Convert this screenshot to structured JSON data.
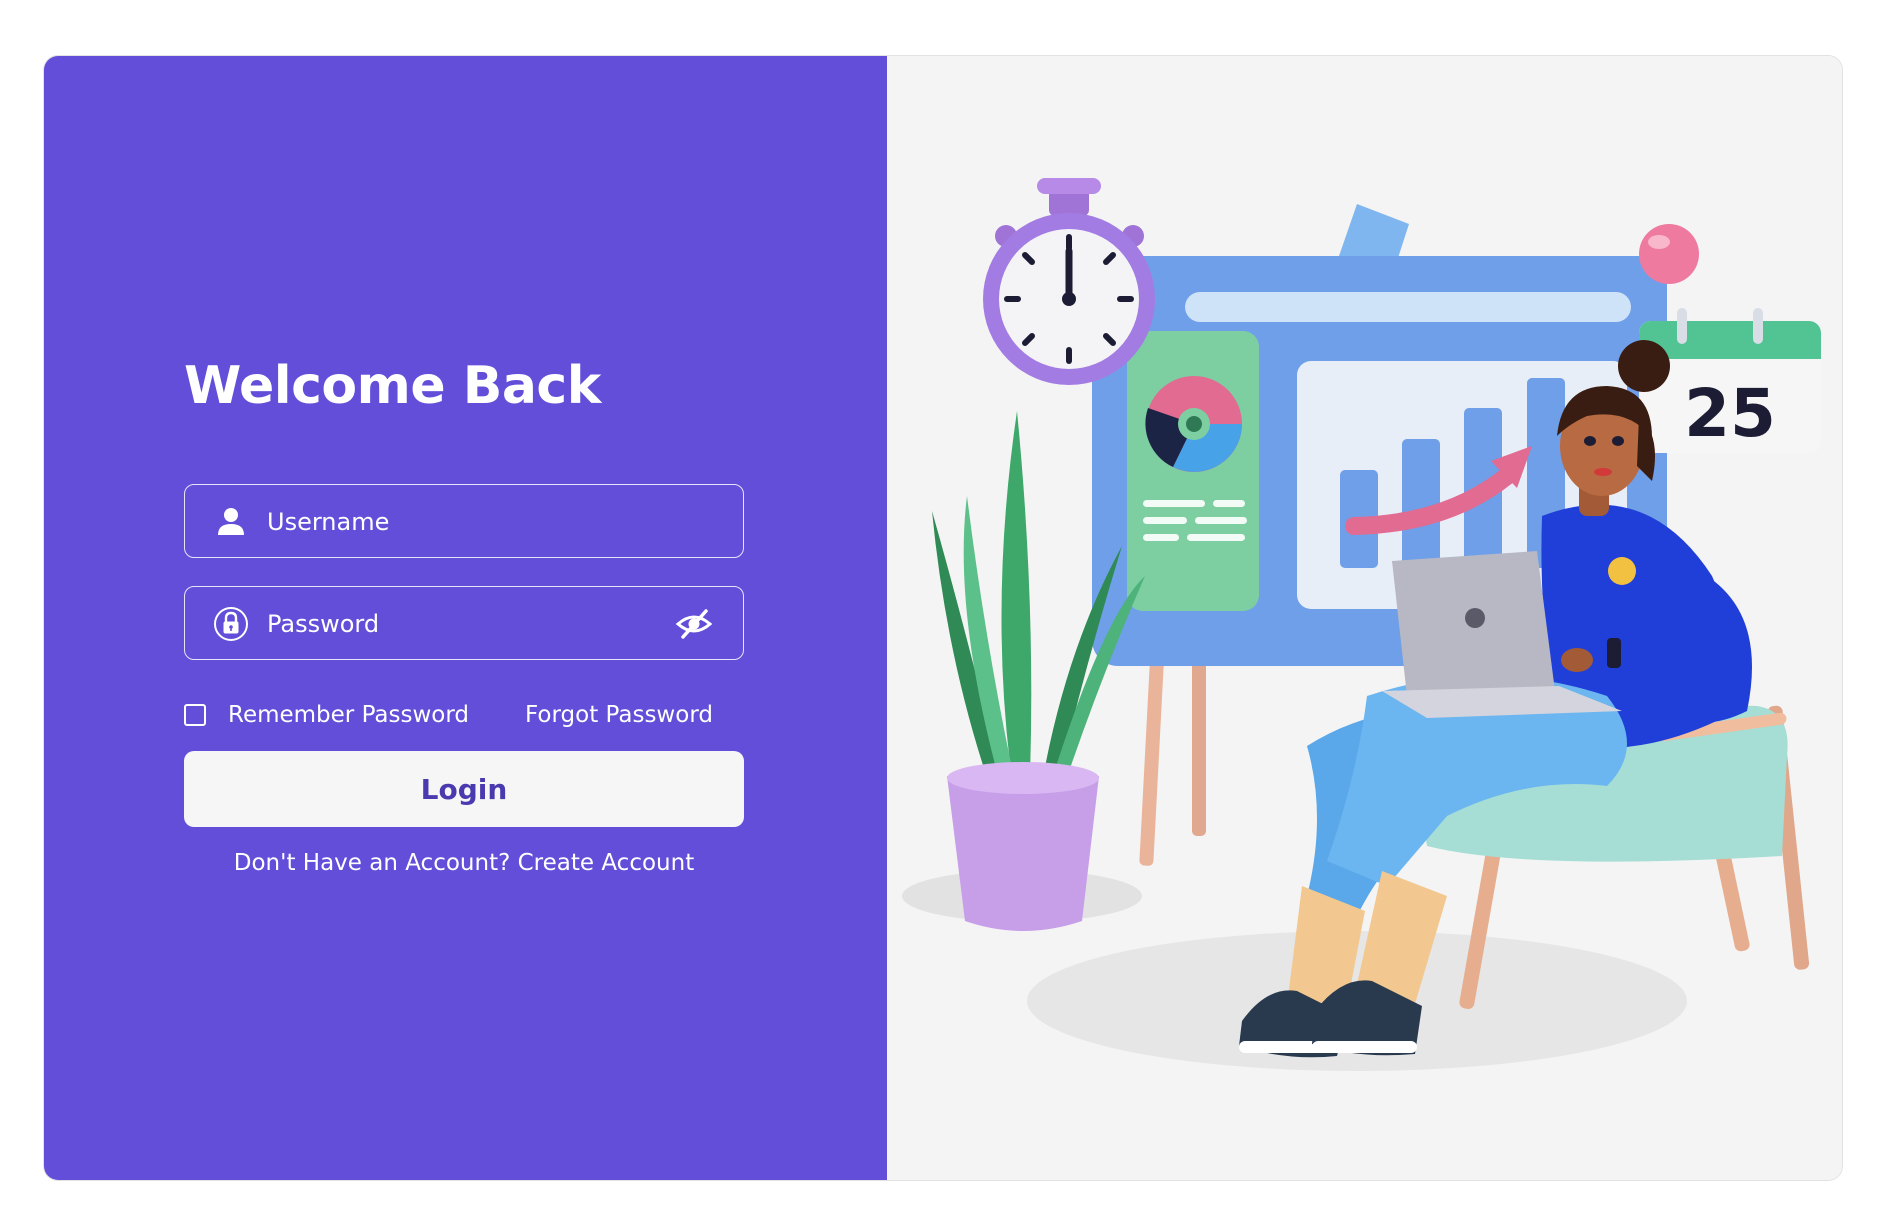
{
  "login": {
    "title": "Welcome Back",
    "username": {
      "placeholder": "Username",
      "value": ""
    },
    "password": {
      "placeholder": "Password",
      "value": ""
    },
    "remember_label": "Remember Password",
    "remember_checked": false,
    "forgot_label": "Forgot Password",
    "login_label": "Login",
    "signup_prefix": "Don't Have an Account?",
    "signup_link": "Create Account"
  },
  "illustration": {
    "calendar_number": "25",
    "icons": [
      "stopwatch-icon",
      "calendar-icon",
      "presentation-board",
      "plant-pot",
      "person-with-laptop"
    ]
  },
  "colors": {
    "accent": "#624ed9",
    "button_text": "#4a3ab0",
    "right_background": "#f4f4f4"
  }
}
